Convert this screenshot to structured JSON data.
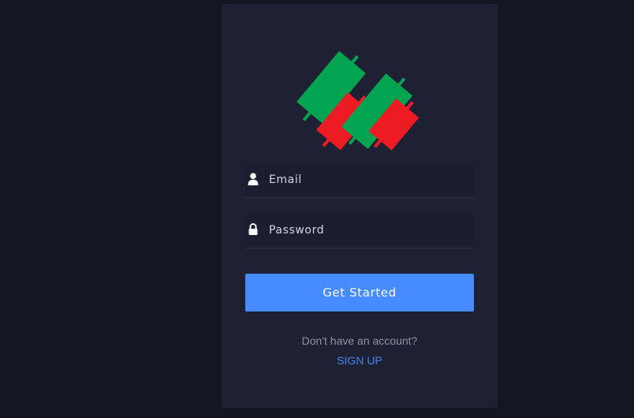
{
  "logo": {
    "icon": "candlestick-logo",
    "colors": {
      "bullish": "#00a34f",
      "bearish": "#ed1c24"
    }
  },
  "form": {
    "email_placeholder": "Email",
    "email_icon": "user-icon",
    "password_placeholder": "Password",
    "password_icon": "lock-icon",
    "submit_label": "Get Started"
  },
  "footer": {
    "prompt_text": "Don't have an account?",
    "signup_label": "SIGN UP"
  },
  "colors": {
    "background": "#131722",
    "card": "#1e2133",
    "accent": "#468bff",
    "link": "#3f86f3"
  }
}
